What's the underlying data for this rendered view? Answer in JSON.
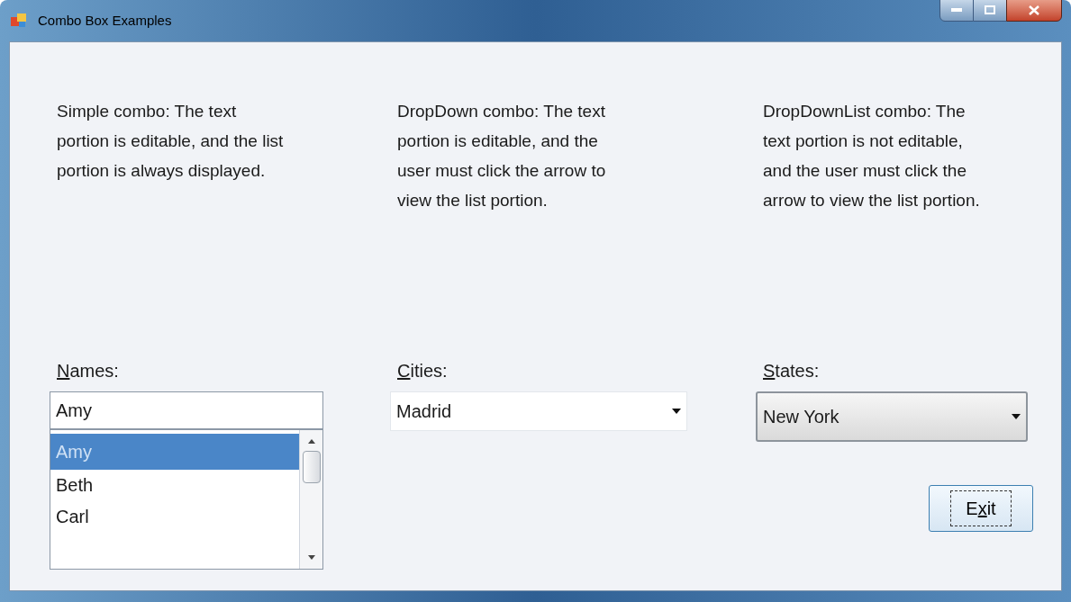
{
  "window": {
    "title": "Combo Box Examples"
  },
  "columns": [
    {
      "kind": "simple",
      "description": "Simple combo: The text portion is editable, and the list portion is always displayed.",
      "label": [
        {
          "text": "N",
          "underlined": true
        },
        {
          "text": "ames:",
          "underlined": false
        }
      ],
      "value": "Amy",
      "items": [
        {
          "text": "Amy",
          "selected": true
        },
        {
          "text": "Beth",
          "selected": false
        },
        {
          "text": "Carl",
          "selected": false
        }
      ]
    },
    {
      "kind": "dropdown",
      "description": "DropDown combo: The text portion is editable, and the user must click the arrow to view the list portion.",
      "label": [
        {
          "text": "C",
          "underlined": true
        },
        {
          "text": "ities:",
          "underlined": false
        }
      ],
      "value": "Madrid"
    },
    {
      "kind": "dropdownlist",
      "description": "DropDownList combo: The text portion is not editable, and the user must click the arrow to view the list portion.",
      "label": [
        {
          "text": "S",
          "underlined": true
        },
        {
          "text": "tates:",
          "underlined": false
        }
      ],
      "value": "New York"
    }
  ],
  "exit_button": {
    "label": [
      {
        "text": "E",
        "underlined": false
      },
      {
        "text": "x",
        "underlined": true
      },
      {
        "text": "it",
        "underlined": false
      }
    ],
    "focused": true
  }
}
